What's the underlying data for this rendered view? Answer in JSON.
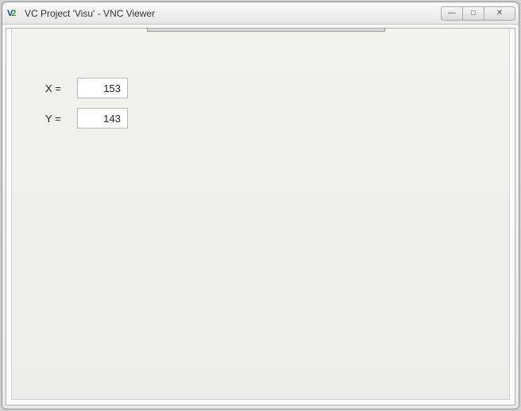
{
  "window": {
    "title": "VC Project 'Visu' - VNC Viewer"
  },
  "controls": {
    "minimize_glyph": "—",
    "maximize_glyph": "□",
    "close_glyph": "✕"
  },
  "fields": {
    "x": {
      "label": "X =",
      "value": "153"
    },
    "y": {
      "label": "Y =",
      "value": "143"
    }
  }
}
